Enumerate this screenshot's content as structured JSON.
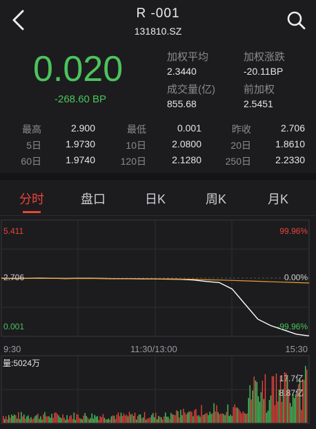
{
  "header": {
    "title": "R -001",
    "code": "131810.SZ",
    "icons": {
      "back": "chevron-left-icon",
      "search": "search-icon"
    }
  },
  "quote": {
    "price": "0.020",
    "change": "-268.60 BP",
    "weighted_avg_label": "加权平均",
    "weighted_avg": "2.3440",
    "weighted_change_label": "加权涨跌",
    "weighted_change": "-20.11BP",
    "volume_label": "成交量(亿)",
    "volume": "855.68",
    "prev_weighted_label": "前加权",
    "prev_weighted": "2.5451"
  },
  "stats": {
    "rows": [
      [
        {
          "label": "最高",
          "value": "2.900"
        },
        {
          "label": "最低",
          "value": "0.001"
        },
        {
          "label": "昨收",
          "value": "2.706"
        }
      ],
      [
        {
          "label": "5日",
          "value": "1.9730"
        },
        {
          "label": "10日",
          "value": "2.0800"
        },
        {
          "label": "20日",
          "value": "1.8610"
        }
      ],
      [
        {
          "label": "60日",
          "value": "1.9740"
        },
        {
          "label": "120日",
          "value": "2.1280"
        },
        {
          "label": "250日",
          "value": "2.2330"
        }
      ]
    ]
  },
  "tabs": [
    "分时",
    "盘口",
    "日K",
    "周K",
    "月K"
  ],
  "active_tab": "分时",
  "colors": {
    "up": "#e8443b",
    "down": "#4cc35d",
    "price_line": "#ffffff",
    "avg_line": "#f0a030"
  },
  "chart": {
    "y_left_top": "5.411",
    "y_left_mid": "2.706",
    "y_left_bottom": "0.001",
    "y_right_top": "99.96%",
    "y_right_mid": "0.00%",
    "y_right_bottom": "-99.96%",
    "x_start": "9:30",
    "x_mid": "11:30/13:00",
    "x_end": "15:30",
    "volume_label": "量:5024万",
    "volume_top": "17.7亿",
    "volume_mid": "8.87亿"
  },
  "chart_data": {
    "type": "line",
    "title": "",
    "ylim": [
      0.001,
      5.411
    ],
    "prev_close": 2.706,
    "series": [
      {
        "values": [
          2.706,
          2.69,
          2.7,
          2.71,
          2.7,
          2.69,
          2.7,
          2.7,
          2.69,
          2.68,
          2.68,
          2.67,
          2.67,
          2.66,
          2.65,
          2.62,
          2.55,
          2.5,
          2.2,
          1.5,
          0.8,
          0.5,
          0.3,
          0.1,
          0.02
        ]
      },
      {
        "values": [
          2.706,
          2.7,
          2.7,
          2.7,
          2.7,
          2.69,
          2.69,
          2.69,
          2.69,
          2.68,
          2.68,
          2.68,
          2.67,
          2.67,
          2.66,
          2.65,
          2.63,
          2.62,
          2.6,
          2.58,
          2.56,
          2.54,
          2.52,
          2.5,
          2.48
        ]
      }
    ]
  }
}
